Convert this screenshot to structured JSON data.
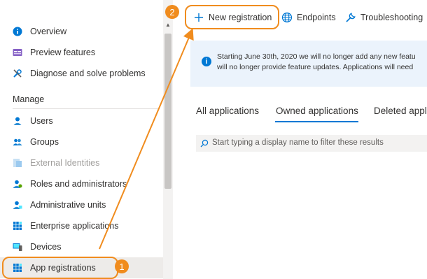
{
  "sidebar": {
    "items_top": [
      {
        "label": "Overview",
        "icon": "info-icon"
      },
      {
        "label": "Preview features",
        "icon": "preview-icon"
      },
      {
        "label": "Diagnose and solve problems",
        "icon": "wrench-icon"
      }
    ],
    "section_header": "Manage",
    "items_manage": [
      {
        "label": "Users",
        "icon": "user-icon"
      },
      {
        "label": "Groups",
        "icon": "group-icon"
      },
      {
        "label": "External Identities",
        "icon": "external-identities-icon"
      },
      {
        "label": "Roles and administrators",
        "icon": "roles-icon"
      },
      {
        "label": "Administrative units",
        "icon": "admin-units-icon"
      },
      {
        "label": "Enterprise applications",
        "icon": "enterprise-apps-icon"
      },
      {
        "label": "Devices",
        "icon": "devices-icon"
      },
      {
        "label": "App registrations",
        "icon": "app-registrations-icon"
      }
    ]
  },
  "toolbar": {
    "new_registration": "New registration",
    "endpoints": "Endpoints",
    "troubleshooting": "Troubleshooting"
  },
  "banner": {
    "line1": "Starting June 30th, 2020 we will no longer add any new featu",
    "line2": "will no longer provide feature updates. Applications will need"
  },
  "tabs": [
    "All applications",
    "Owned applications",
    "Deleted appli"
  ],
  "filter": {
    "placeholder": "Start typing a display name to filter these results"
  },
  "callouts": {
    "step1": "1",
    "step2": "2"
  },
  "colors": {
    "accent": "#0078d4",
    "callout": "#f08c1e",
    "banner_bg": "#ebf3fc"
  }
}
